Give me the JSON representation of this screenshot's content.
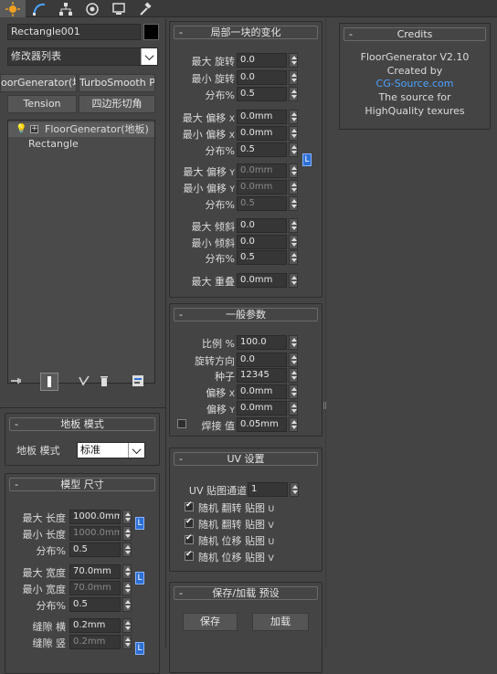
{
  "tabs": [
    {
      "name": "create-tab",
      "icon": "sun-icon"
    },
    {
      "name": "modify-tab",
      "icon": "curve-icon"
    },
    {
      "name": "hierarchy-tab",
      "icon": "hierarchy-icon"
    },
    {
      "name": "motion-tab",
      "icon": "motion-icon"
    },
    {
      "name": "display-tab",
      "icon": "display-icon"
    },
    {
      "name": "utilities-tab",
      "icon": "hammer-icon"
    }
  ],
  "object": {
    "name": "Rectangle001",
    "color": "#000000"
  },
  "modifier_list": {
    "label": "修改器列表"
  },
  "modifier_buttons": {
    "floor": "oorGenerator(地板",
    "turbosmooth": "TurboSmooth Pro",
    "tension": "Tension",
    "quad": "四边形切角"
  },
  "stack": {
    "items": [
      "FloorGenerator(地板)",
      "Rectangle"
    ]
  },
  "floor_mode": {
    "title": "地板 模式",
    "label": "地板 模式",
    "value": "标准"
  },
  "model_size": {
    "title": "模型 尺寸",
    "max_length_label": "最大 长度",
    "max_length": "1000.0mm",
    "min_length_label": "最小 长度",
    "min_length": "1000.0mm",
    "dist1_label": "分布%",
    "dist1": "0.5",
    "max_width_label": "最大 宽度",
    "max_width": "70.0mm",
    "min_width_label": "最小 宽度",
    "min_width": "70.0mm",
    "dist2_label": "分布%",
    "dist2": "0.5",
    "gap_h_label": "缝隙 横",
    "gap_h": "0.2mm",
    "gap_v_label": "缝隙 竖",
    "gap_v": "0.2mm",
    "lock": "L"
  },
  "local_change": {
    "title": "局部一块的变化",
    "max_rot_label": "最大 旋转",
    "max_rot": "0.0",
    "min_rot_label": "最小 旋转",
    "min_rot": "0.0",
    "dist_rot_label": "分布%",
    "dist_rot": "0.5",
    "max_offx_label": "最大 偏移",
    "max_offx_axis": "X",
    "max_offx": "0.0mm",
    "min_offx_label": "最小 偏移",
    "min_offx_axis": "X",
    "min_offx": "0.0mm",
    "dist_offx_label": "分布%",
    "dist_offx": "0.5",
    "max_offy_label": "最大 偏移",
    "max_offy_axis": "Y",
    "max_offy": "0.0mm",
    "min_offy_label": "最小 偏移",
    "min_offy_axis": "Y",
    "min_offy": "0.0mm",
    "dist_offy_label": "分布%",
    "dist_offy": "0.5",
    "max_tilt_label": "最大 倾斜",
    "max_tilt": "0.0",
    "min_tilt_label": "最小 倾斜",
    "min_tilt": "0.0",
    "dist_tilt_label": "分布%",
    "dist_tilt": "0.5",
    "max_overlap_label": "最大 重叠",
    "max_overlap": "0.0mm",
    "lock": "L"
  },
  "general": {
    "title": "一般参数",
    "scale_label": "比例 %",
    "scale": "100.0",
    "rot_dir_label": "旋转方向",
    "rot_dir": "0.0",
    "seed_label": "种子",
    "seed": "12345",
    "offx_label": "偏移",
    "offx_axis": "X",
    "offx": "0.0mm",
    "offy_label": "偏移",
    "offy_axis": "Y",
    "offy": "0.0mm",
    "weld_label": "焊接 值",
    "weld": "0.05mm"
  },
  "uv": {
    "title": "UV 设置",
    "channel_label": "UV 贴图通道",
    "channel": "1",
    "flip_u": "随机 翻转 贴图",
    "flip_u_axis": "U",
    "flip_v": "随机 翻转 贴图",
    "flip_v_axis": "V",
    "offset_u": "随机 位移 贴图",
    "offset_u_axis": "U",
    "offset_v": "随机 位移 贴图",
    "offset_v_axis": "V"
  },
  "preset": {
    "title": "保存/加载 预设",
    "save": "保存",
    "load": "加载"
  },
  "credits": {
    "title": "Credits",
    "line1": "FloorGenerator V2.10",
    "line2": "Created by",
    "link": "CG-Source.com",
    "line3": "The source for",
    "line4": "HighQuality texures"
  },
  "rollout_minus": "-",
  "colors": {
    "accent": "#2c6fd4",
    "link": "#4aa3ff",
    "panel": "#444444"
  }
}
